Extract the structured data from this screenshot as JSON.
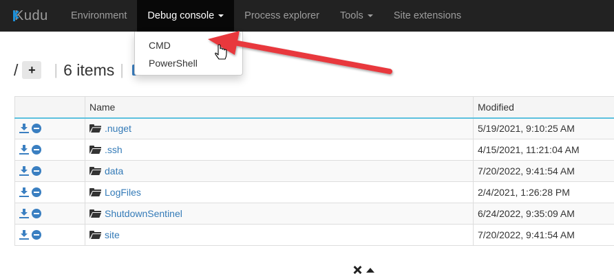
{
  "navbar": {
    "brand": "Kudu",
    "items": [
      {
        "label": "Environment"
      },
      {
        "label": "Debug console"
      },
      {
        "label": "Process explorer"
      },
      {
        "label": "Tools"
      },
      {
        "label": "Site extensions"
      }
    ]
  },
  "dropdown": {
    "items": [
      {
        "label": "CMD"
      },
      {
        "label": "PowerShell"
      }
    ]
  },
  "toolbar": {
    "path": "/",
    "add_label": "+",
    "items_count": "6 items"
  },
  "table": {
    "headers": [
      "",
      "Name",
      "Modified"
    ],
    "rows": [
      {
        "name": ".nuget",
        "modified": "5/19/2021, 9:10:25 AM"
      },
      {
        "name": ".ssh",
        "modified": "4/15/2021, 11:21:04 AM"
      },
      {
        "name": "data",
        "modified": "7/20/2022, 9:41:54 AM"
      },
      {
        "name": "LogFiles",
        "modified": "2/4/2021, 1:26:28 PM"
      },
      {
        "name": "ShutdownSentinel",
        "modified": "6/24/2022, 9:35:09 AM"
      },
      {
        "name": "site",
        "modified": "7/20/2022, 9:41:54 AM"
      }
    ]
  },
  "colors": {
    "navbar_bg": "#222222",
    "accent_blue": "#3a7fc1",
    "link_blue": "#337ab7",
    "arrow_red": "#e8373e"
  }
}
